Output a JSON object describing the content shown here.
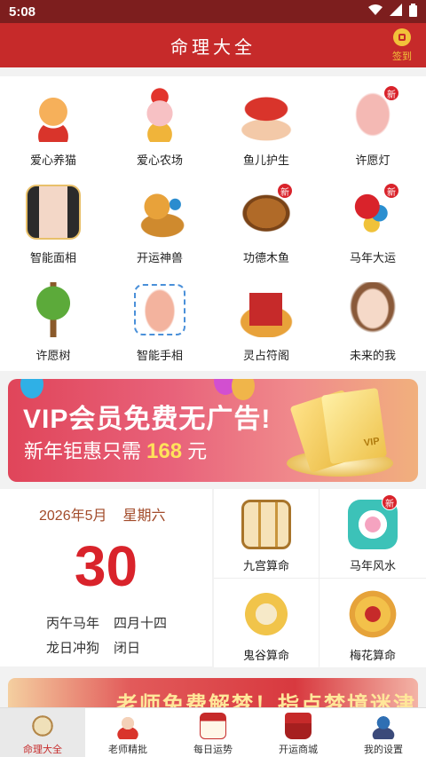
{
  "status_bar": {
    "time": "5:08"
  },
  "header": {
    "title": "命理大全",
    "signin_label": "签到"
  },
  "grid_items": [
    {
      "label": "爱心养猫",
      "icon": "cat-icon",
      "badge": ""
    },
    {
      "label": "爱心农场",
      "icon": "pig-icon",
      "badge": ""
    },
    {
      "label": "鱼儿护生",
      "icon": "fish-icon",
      "badge": ""
    },
    {
      "label": "许愿灯",
      "icon": "lantern-icon",
      "badge": "新"
    },
    {
      "label": "智能面相",
      "icon": "face-reading-icon",
      "badge": ""
    },
    {
      "label": "开运神兽",
      "icon": "lion-beast-icon",
      "badge": ""
    },
    {
      "label": "功德木鱼",
      "icon": "wooden-fish-icon",
      "badge": "新"
    },
    {
      "label": "马年大运",
      "icon": "horse-icon",
      "badge": "新"
    },
    {
      "label": "许愿树",
      "icon": "wish-tree-icon",
      "badge": ""
    },
    {
      "label": "智能手相",
      "icon": "palm-icon",
      "badge": ""
    },
    {
      "label": "灵占符阁",
      "icon": "talisman-icon",
      "badge": ""
    },
    {
      "label": "未来的我",
      "icon": "future-self-icon",
      "badge": ""
    }
  ],
  "banner": {
    "line1": "VIP会员免费无广告!",
    "line2_prefix": "新年钜惠只需",
    "price": "168",
    "unit": "元"
  },
  "calendar": {
    "month": "2026年5月",
    "weekday": "星期六",
    "day": "30",
    "ganzhi": "丙午马年",
    "lunar": "四月十四",
    "clash": "龙日冲狗",
    "officer": "闭日"
  },
  "services": [
    {
      "label": "九宫算命",
      "icon": "nine-palace-icon",
      "badge": ""
    },
    {
      "label": "马年风水",
      "icon": "compass-icon",
      "badge": "新"
    },
    {
      "label": "鬼谷算命",
      "icon": "guigu-icon",
      "badge": ""
    },
    {
      "label": "梅花算命",
      "icon": "plum-bagua-icon",
      "badge": ""
    }
  ],
  "promo": {
    "text": "老师免费解梦！指点梦境迷津！"
  },
  "tabs": [
    {
      "label": "命理大全",
      "icon": "luopan-icon",
      "active": true
    },
    {
      "label": "老师精批",
      "icon": "master-icon",
      "active": false
    },
    {
      "label": "每日运势",
      "icon": "calendar-ji-icon",
      "active": false
    },
    {
      "label": "开运商城",
      "icon": "shop-icon",
      "active": false
    },
    {
      "label": "我的设置",
      "icon": "profile-icon",
      "active": false
    }
  ],
  "colors": {
    "primary": "#c62a2a",
    "status": "#7d1e1e",
    "badge": "#d9232b",
    "gold": "#f2c23a"
  }
}
